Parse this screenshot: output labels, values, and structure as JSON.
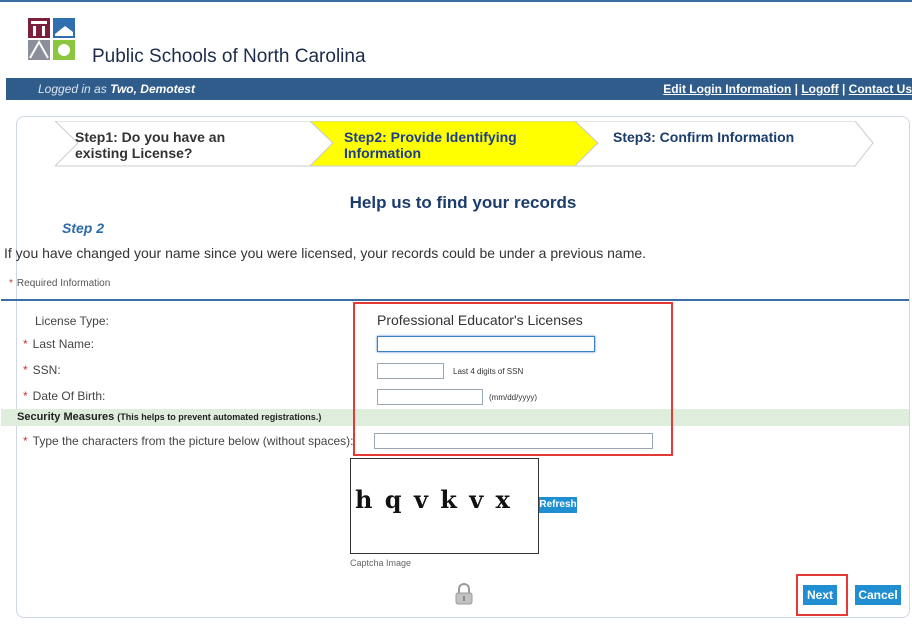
{
  "header": {
    "site_title": "Public Schools of North Carolina",
    "logged_prefix": "Logged in as ",
    "logged_user": "Two, Demotest",
    "links": [
      "Edit Login Information",
      "Logoff",
      "Contact Us"
    ],
    "link_separator": " | "
  },
  "wizard": {
    "steps": [
      {
        "line1": "Step1: Do you have an",
        "line2": "existing License?",
        "state": "done"
      },
      {
        "line1": "Step2: Provide Identifying",
        "line2": "Information",
        "state": "current"
      },
      {
        "line1": "Step3: Confirm Information",
        "line2": "",
        "state": "pending"
      }
    ],
    "current_fill": "#ffff00"
  },
  "form": {
    "heading": "Help us to find your records",
    "step_label": "Step 2",
    "intro": "If you have changed your name since you were licensed, your records could be under a previous name.",
    "required_info": "Required Information",
    "license_type_label": "License Type:",
    "license_type_value": "Professional Educator's Licenses",
    "last_name_label": "Last Name:",
    "last_name_value": "",
    "ssn_label": "SSN:",
    "ssn_value": "",
    "ssn_hint": "Last 4 digits of SSN",
    "dob_label": "Date Of Birth:",
    "dob_value": "",
    "dob_hint": "(mm/dd/yyyy)",
    "required_marker": "*",
    "security_title": "Security Measures",
    "security_note": "(This helps to prevent automated registrations.)",
    "captcha_label": "Type the characters from the picture below (without spaces):",
    "captcha_value": "",
    "captcha_text": "h q v k v x",
    "captcha_caption": "Captcha Image",
    "refresh_label": "Refresh",
    "next_label": "Next",
    "cancel_label": "Cancel"
  },
  "colors": {
    "header_bar": "#2f5c8a",
    "accent_blue": "#1f8fd1",
    "security_bar": "#dfeedc",
    "highlight_red": "#e53935"
  }
}
